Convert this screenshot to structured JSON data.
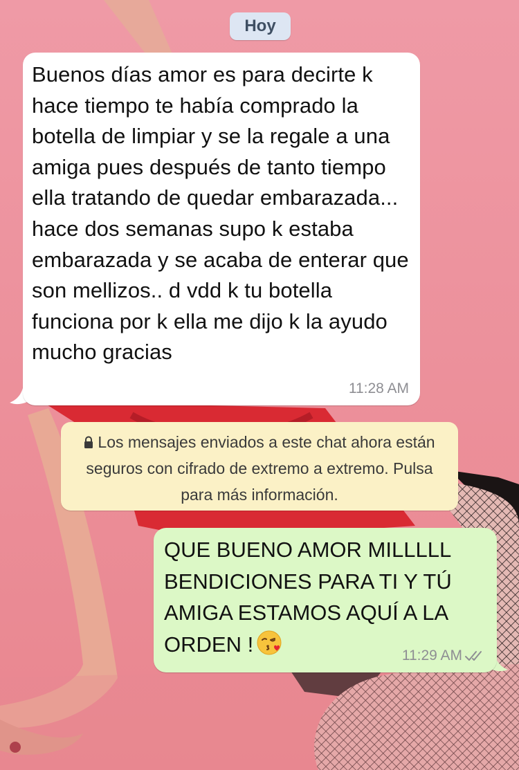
{
  "chat": {
    "date_label": "Hoy",
    "messages": [
      {
        "direction": "incoming",
        "text": "Buenos días amor es para decirte k hace tiempo te había comprado la botella de limpiar y se la regale a una amiga pues después de tanto tiempo ella tratando de  quedar embarazada... hace dos semanas supo k estaba embarazada y se acaba de enterar que son mellizos.. d vdd k tu botella funciona por k ella me dijo k la ayudo mucho gracias",
        "time": "11:28 AM"
      },
      {
        "direction": "outgoing",
        "text": "QUE BUENO AMOR MILLLLL BENDICIONES PARA TI Y TÚ AMIGA ESTAMOS AQUÍ A LA ORDEN !",
        "emoji": "kissing-face-with-heart-emoji",
        "time": "11:29 AM",
        "status": "read"
      }
    ],
    "system_notice": {
      "icon": "lock-icon",
      "text": "Los mensajes enviados a este chat ahora están seguros con cifrado de extremo a extremo. Pulsa para más información."
    }
  },
  "colors": {
    "incoming_bubble": "#ffffff",
    "outgoing_bubble": "#dcf8c6",
    "notice_bg": "#fbf1c6",
    "date_chip_bg": "#dde6f3",
    "timestamp": "#8e8e93",
    "wallpaper": "#ec8e9a"
  }
}
